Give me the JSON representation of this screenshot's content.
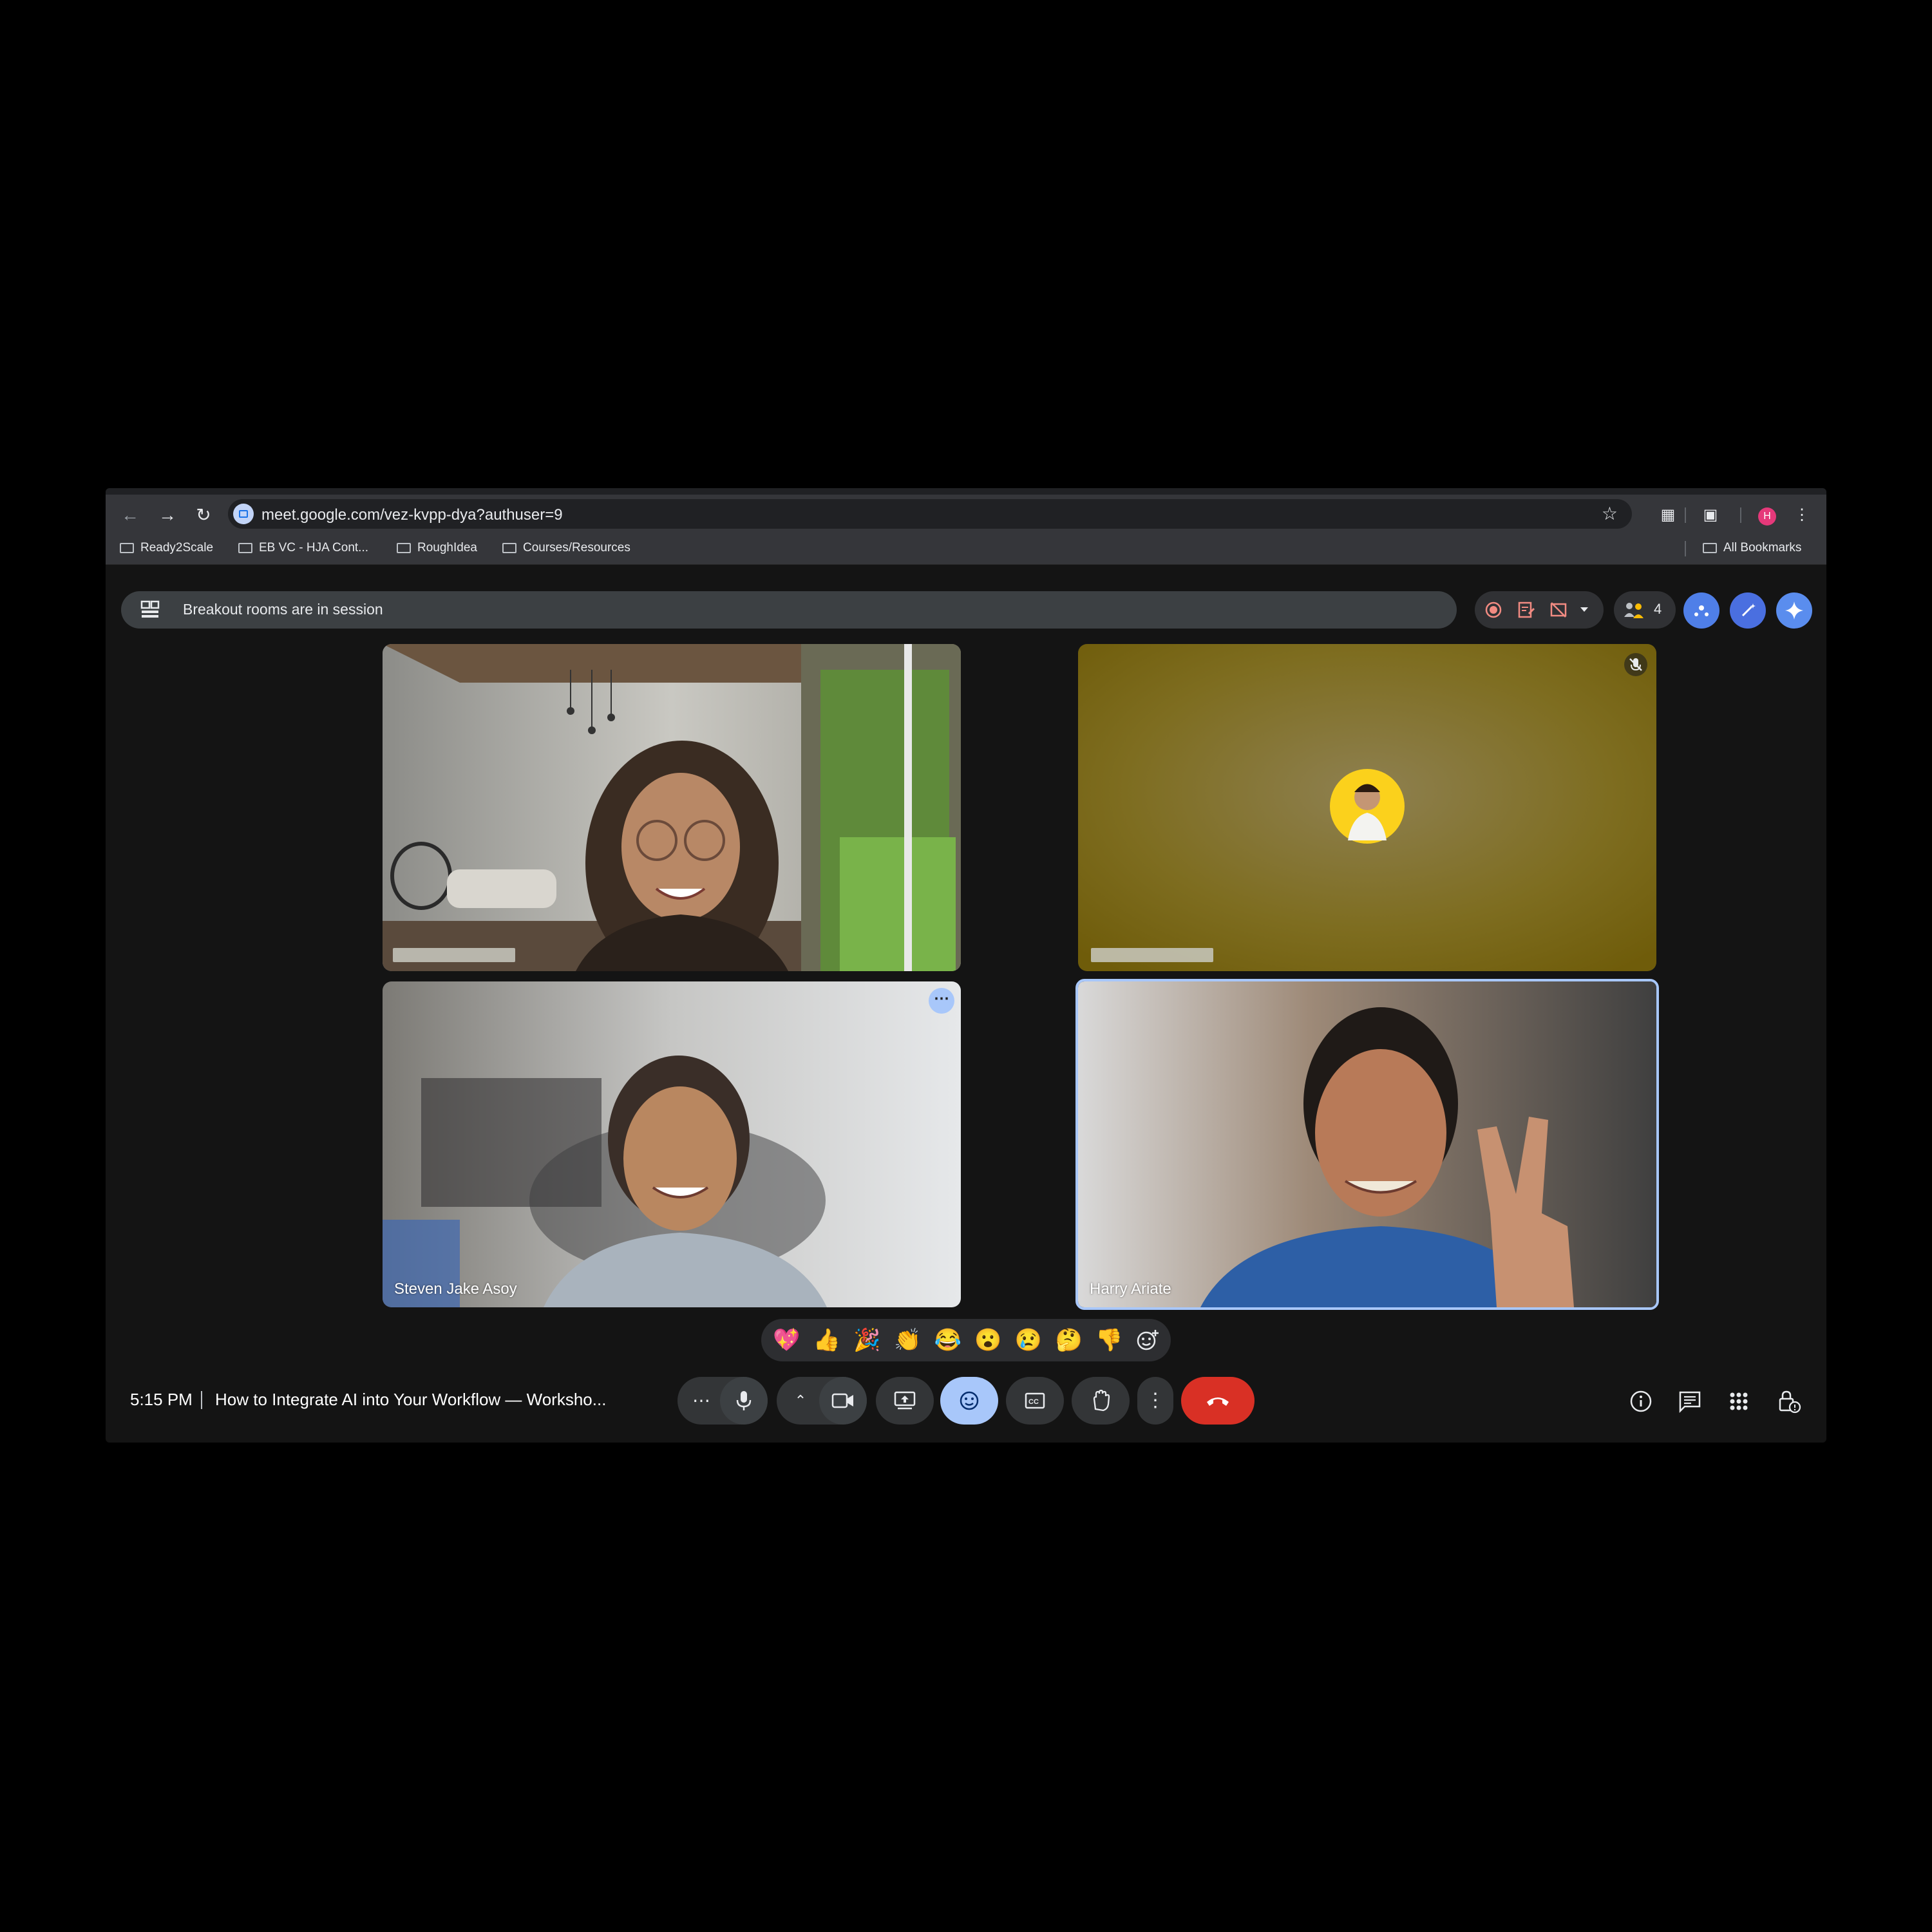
{
  "browser": {
    "url": "meet.google.com/vez-kvpp-dya?authuser=9",
    "profile_initial": "H",
    "bookmarks": [
      "Ready2Scale",
      "EB VC - HJA Cont...",
      "RoughIdea",
      "Courses/Resources"
    ],
    "all_bookmarks": "All Bookmarks"
  },
  "meet": {
    "banner_text": "Breakout rooms are in session",
    "participant_count": "4",
    "tiles": [
      {
        "name": "",
        "muted": false
      },
      {
        "name": "",
        "muted": true
      },
      {
        "name": "Steven Jake Asoy",
        "muted": false
      },
      {
        "name": "Harry Ariate",
        "muted": false,
        "speaking": true
      }
    ],
    "reactions": [
      "💖",
      "👍",
      "🎉",
      "👏",
      "😂",
      "😮",
      "😢",
      "🤔",
      "👎"
    ],
    "time": "5:15 PM",
    "meeting_title": "How to Integrate AI into Your Workflow — Worksho...",
    "colors": {
      "end_call": "#d93025",
      "active_control": "#a8c7fa",
      "speaking_border": "#a8c7fa"
    }
  }
}
